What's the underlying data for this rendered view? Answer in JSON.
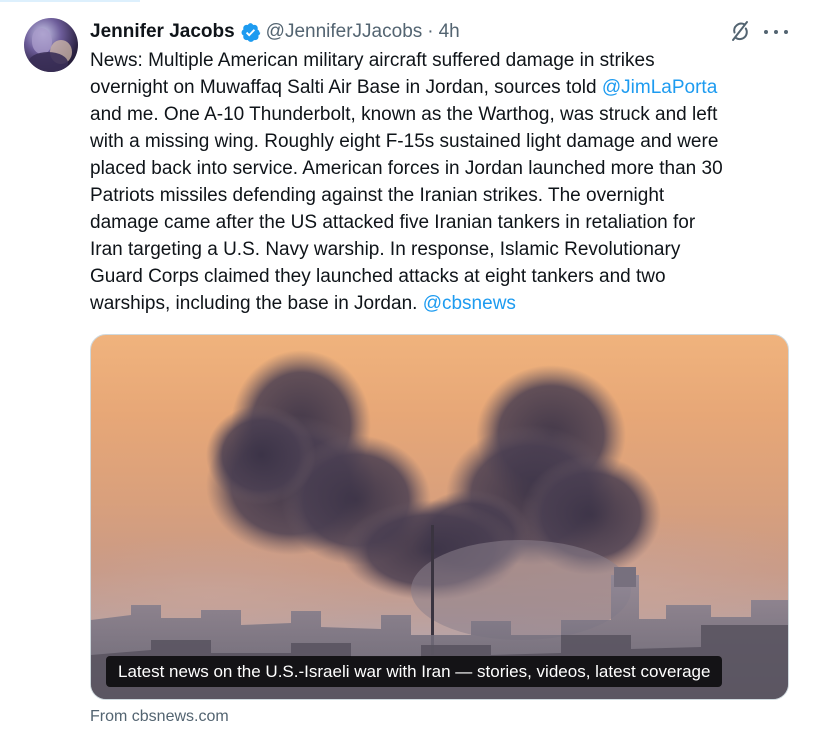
{
  "tweet": {
    "author": {
      "name": "Jennifer Jacobs",
      "handle": "@JenniferJJacobs",
      "separator": "·",
      "time": "4h",
      "verified": true
    },
    "text_lines": [
      {
        "text": "News: Multiple American military aircraft suffered damage in strikes"
      },
      {
        "text": "overnight on Muwaffaq Salti Air Base in Jordan, sources told ",
        "mention": "@JimLaPorta"
      },
      {
        "text": "and me. One A-10 Thunderbolt, known as the Warthog, was struck and left"
      },
      {
        "text": "with a missing wing. Roughly eight F-15s sustained light damage and were"
      },
      {
        "text": "placed back into service. American forces in Jordan launched more than 30"
      },
      {
        "text": "Patriots missiles defending against the Iranian strikes. The overnight"
      },
      {
        "text": "damage came after the US attacked five Iranian tankers in retaliation for"
      },
      {
        "text": "Iran targeting a U.S. Navy warship. In response, Islamic Revolutionary"
      },
      {
        "text": "Guard Corps claimed they launched attacks at eight tankers and two"
      },
      {
        "text": "warships, including the base in Jordan. ",
        "mention": "@cbsnews"
      }
    ],
    "card": {
      "caption": "Latest news on the U.S.-Israeli war with Iran — stories, videos, latest coverage",
      "source": "From cbsnews.com"
    },
    "icons": {
      "verified": "verified-badge-icon",
      "grok": "grok-icon",
      "more": "more-options-icon"
    },
    "colors": {
      "accent": "#1d9bf0",
      "text": "#0f1419",
      "secondary": "#536471"
    }
  }
}
